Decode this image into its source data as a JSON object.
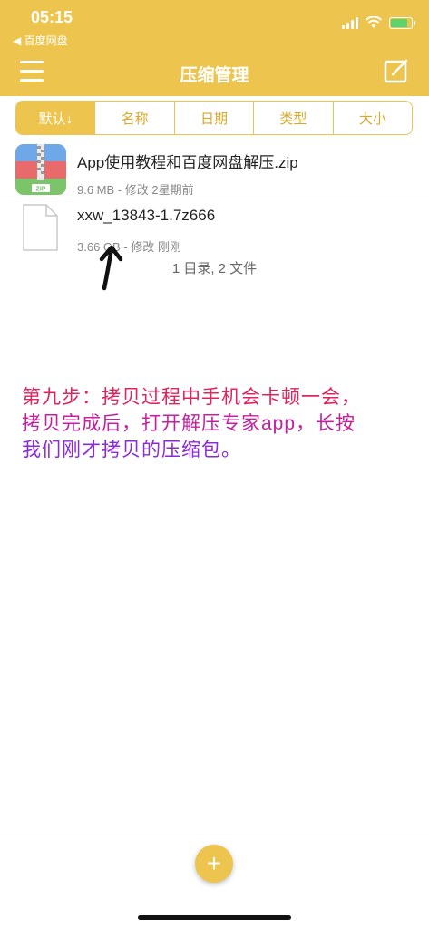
{
  "status_bar": {
    "time": "05:15",
    "back_label": "◀ 百度网盘"
  },
  "header": {
    "title": "压缩管理"
  },
  "sort_tabs": [
    {
      "label": "默认↓",
      "active": true
    },
    {
      "label": "名称"
    },
    {
      "label": "日期"
    },
    {
      "label": "类型"
    },
    {
      "label": "大小"
    }
  ],
  "files": [
    {
      "name": "App使用教程和百度网盘解压.zip",
      "meta": "9.6 MB - 修改 2星期前",
      "icon": "zip-archive-icon"
    },
    {
      "name": "xxw_13843-1.7z666",
      "meta": "3.66 GB - 修改 刚刚",
      "icon": "blank-file-icon"
    }
  ],
  "summary": "1 目录, 2 文件",
  "instruction": {
    "line1": "第九步：拷贝过程中手机会卡顿一会，",
    "line2": "拷贝完成后，打开解压专家app，长按",
    "line3": "我们刚才拷贝的压缩包。"
  },
  "colors": {
    "accent": "#ecc44e",
    "instruction_red": "#e0245e",
    "instruction_purple": "#8a2ad8"
  },
  "fab": {
    "icon": "plus-icon"
  }
}
